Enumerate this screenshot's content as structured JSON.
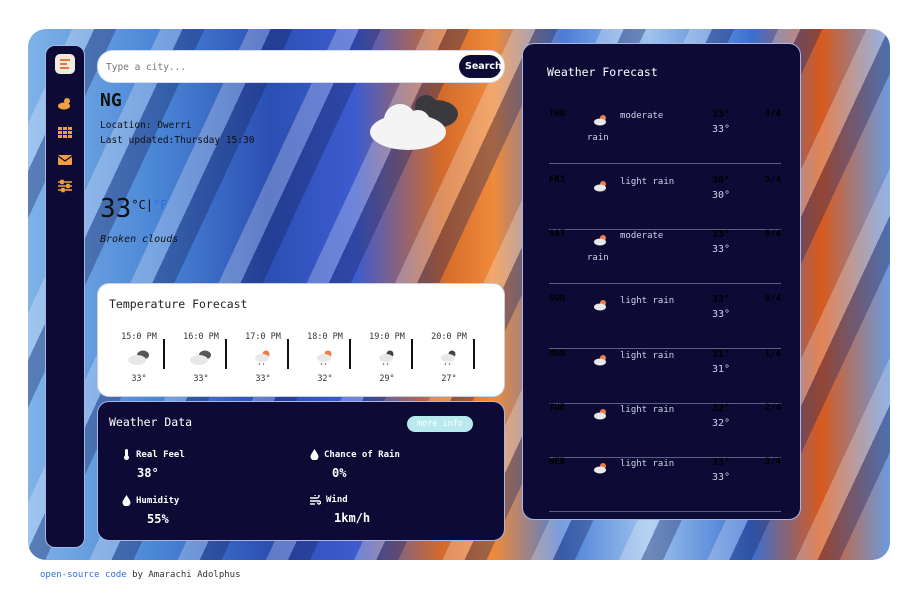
{
  "colors": {
    "panel": "#0d0a35",
    "accent": "#2b6fd6",
    "more_btn": "#b8e9ef",
    "sun": "#f07a4a"
  },
  "sidebar": {
    "items": [
      {
        "icon": "weather-icon"
      },
      {
        "icon": "grid-icon"
      },
      {
        "icon": "mail-icon"
      },
      {
        "icon": "sliders-icon"
      }
    ]
  },
  "search": {
    "placeholder": "Type a city...",
    "button": "Search"
  },
  "current": {
    "country": "NG",
    "location": "Location: Owerri",
    "updated": "Last updated:Thursday 15:30",
    "temp": "33",
    "unit_c": "°C|",
    "unit_f": "°F",
    "description": "Broken clouds",
    "icon": "broken-clouds-icon"
  },
  "temperature_forecast": {
    "title": "Temperature Forecast",
    "slots": [
      {
        "time": "15:0 PM",
        "temp": "33°",
        "icon": "clouds-icon"
      },
      {
        "time": "16:0 PM",
        "temp": "33°",
        "icon": "clouds-icon"
      },
      {
        "time": "17:0 PM",
        "temp": "33°",
        "icon": "rain-icon"
      },
      {
        "time": "18:0 PM",
        "temp": "32°",
        "icon": "rain-icon"
      },
      {
        "time": "19:0 PM",
        "temp": "29°",
        "icon": "night-rain-icon"
      },
      {
        "time": "20:0 PM",
        "temp": "27°",
        "icon": "night-rain-icon"
      }
    ]
  },
  "weather_data": {
    "title": "Weather Data",
    "more_button": "more info",
    "real_feel": {
      "label": "Real Feel",
      "value": "38°",
      "icon": "thermometer-icon"
    },
    "chance_of_rain": {
      "label": "Chance of Rain",
      "value": "0%",
      "icon": "droplet-icon"
    },
    "humidity": {
      "label": "Humidity",
      "value": "55%",
      "icon": "droplet-icon"
    },
    "wind": {
      "label": "Wind",
      "value": "1km/h",
      "icon": "wind-icon"
    }
  },
  "forecast": {
    "title": "Weather Forecast",
    "days": [
      {
        "day": "THU",
        "desc": "moderate",
        "desc2": "rain",
        "hi": "33°",
        "lo": "33°",
        "right": "4/4"
      },
      {
        "day": "FRI",
        "desc": "light rain",
        "desc2": "",
        "hi": "30°",
        "lo": "30°",
        "right": "5/4"
      },
      {
        "day": "SAT",
        "desc": "moderate",
        "desc2": "rain",
        "hi": "33°",
        "lo": "33°",
        "right": "6/4"
      },
      {
        "day": "SUN",
        "desc": "light rain",
        "desc2": "",
        "hi": "33°",
        "lo": "33°",
        "right": "0/4"
      },
      {
        "day": "MON",
        "desc": "light rain",
        "desc2": "",
        "hi": "31°",
        "lo": "31°",
        "right": "1/4"
      },
      {
        "day": "TUE",
        "desc": "light rain",
        "desc2": "",
        "hi": "32°",
        "lo": "32°",
        "right": "2/4"
      },
      {
        "day": "WED",
        "desc": "light rain",
        "desc2": "",
        "hi": "33°",
        "lo": "33°",
        "right": "3/4"
      }
    ]
  },
  "footer": {
    "link": "open-source code",
    "text": " by Amarachi Adolphus"
  }
}
